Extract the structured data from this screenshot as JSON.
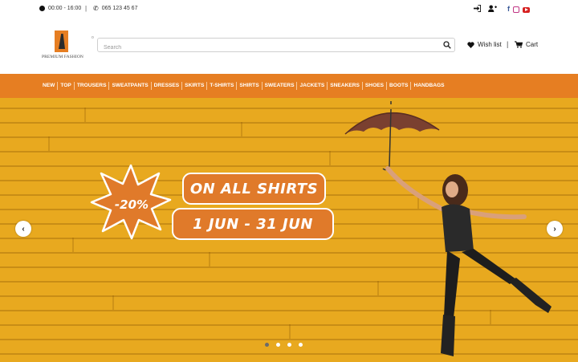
{
  "topbar": {
    "hours": "00:00 - 16:00",
    "separator": "|",
    "phone": "065 123 45 67",
    "icons": [
      "clock-icon",
      "phone-icon",
      "login-icon",
      "add-user-icon",
      "facebook-icon",
      "instagram-icon",
      "youtube-icon"
    ]
  },
  "header": {
    "logo_text": "PREMIUM FASHION",
    "search_placeholder": "Search",
    "wishlist_label": "Wish list",
    "separator": "|",
    "cart_label": "Cart"
  },
  "nav": {
    "items": [
      "NEW",
      "TOP",
      "TROUSERS",
      "SWEATPANTS",
      "DRESSES",
      "SKIRTS",
      "T-SHIRTS",
      "SHIRTS",
      "SWEATERS",
      "JACKETS",
      "SNEAKERS",
      "SHOES",
      "BOOTS",
      "HANDBAGS"
    ]
  },
  "hero": {
    "discount": "-20%",
    "headline": "ON ALL SHIRTS",
    "dates": "1 JUN - 31 JUN",
    "prev_arrow": "‹",
    "next_arrow": "›",
    "slide_count": 4,
    "active_slide": 1
  },
  "colors": {
    "accent": "#e67e22",
    "hero_background": "#e8a91f",
    "pill": "#e07a2a"
  }
}
